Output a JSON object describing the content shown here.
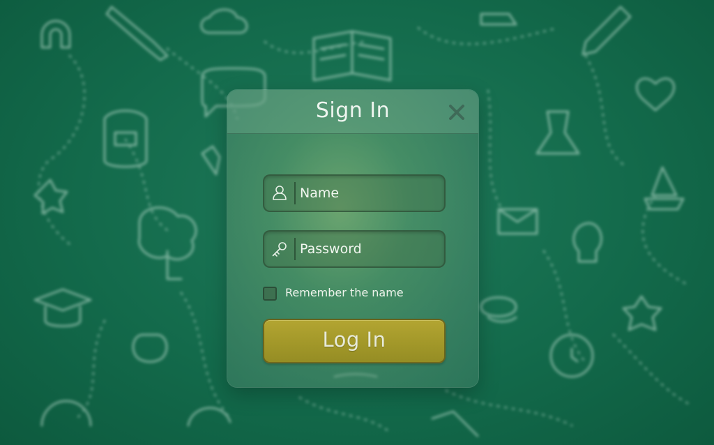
{
  "dialog": {
    "title": "Sign In",
    "close_icon": "close-icon"
  },
  "fields": {
    "name": {
      "placeholder": "Name",
      "value": "",
      "icon": "user-icon"
    },
    "password": {
      "placeholder": "Password",
      "value": "",
      "icon": "key-icon"
    }
  },
  "remember": {
    "label": "Remember the name",
    "checked": false
  },
  "login_button": {
    "label": "Log In"
  },
  "colors": {
    "background": "#136a4b",
    "button": "#a4992a",
    "text": "#eef5ef",
    "doodle_stroke": "#cfe9dc"
  }
}
